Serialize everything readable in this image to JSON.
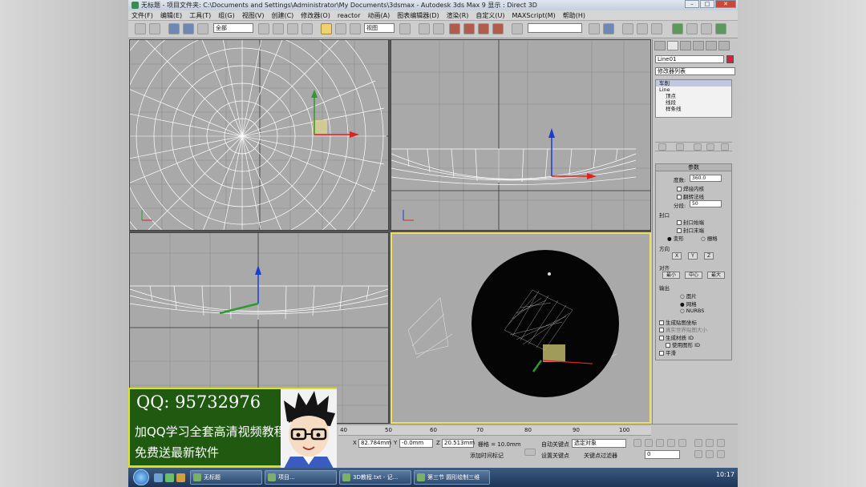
{
  "window": {
    "title": "无标题 - 项目文件夹: C:\\Documents and Settings\\Administrator\\My Documents\\3dsmax - Autodesk 3ds Max 9 显示 : Direct 3D"
  },
  "menu": [
    "文件(F)",
    "编辑(E)",
    "工具(T)",
    "组(G)",
    "视图(V)",
    "创建(C)",
    "修改器(O)",
    "reactor",
    "动画(A)",
    "图表编辑器(D)",
    "渲染(R)",
    "自定义(U)",
    "MAXScript(M)",
    "帮助(H)"
  ],
  "toolbar": {
    "selection_filter": "全部",
    "ref_coord": "视图",
    "named_selection": ""
  },
  "command_panel": {
    "object_name": "Line01",
    "object_color": "#d4243c",
    "modifier_list": "修改器列表",
    "stack": [
      "车削",
      "Line",
      "顶点",
      "线段",
      "样条线"
    ],
    "params_title": "参数",
    "degrees_label": "度数:",
    "degrees_value": "360.0",
    "weld_core": "焊接内核",
    "flip_normals": "翻转法线",
    "segments_label": "分段:",
    "segments_value": "50",
    "capping": "封口",
    "cap_start": "封口始端",
    "cap_end": "封口末端",
    "morph": "变形",
    "grid": "栅格",
    "direction": "方向",
    "x": "X",
    "y": "Y",
    "z": "Z",
    "align": "对齐",
    "min": "最小",
    "center": "中心",
    "max": "最大",
    "output": "输出",
    "patch": "面片",
    "mesh": "网格",
    "nurbs": "NURBS",
    "gen_map": "生成贴图坐标",
    "real_world": "真实世界贴图大小",
    "gen_mat": "生成材质 ID",
    "use_shape": "使用图形 ID",
    "smooth": "平滑"
  },
  "status": {
    "ruler_ticks": [
      "40",
      "50",
      "60",
      "70",
      "80",
      "90",
      "100"
    ],
    "x_value": "82.784mm",
    "y_value": "-0.0mm",
    "z_value": "20.513mm",
    "grid_label": "栅格 = 10.0mm",
    "auto_key": "自动关键点",
    "selected": "选定对象",
    "set_key": "设置关键点",
    "key_filters": "关键点过滤器",
    "add_time_tag": "添加时间标记",
    "frame": "0"
  },
  "promo": {
    "qq": "QQ: 95732976",
    "line2": "加QQ学习全套高清视频教程",
    "line3": "免费送最新软件"
  },
  "taskbar": {
    "tasks": [
      "无标题",
      "项目...",
      "3D教程.txt - 记...",
      "第三节 圆形绘制三维"
    ],
    "clock": "10:17"
  }
}
